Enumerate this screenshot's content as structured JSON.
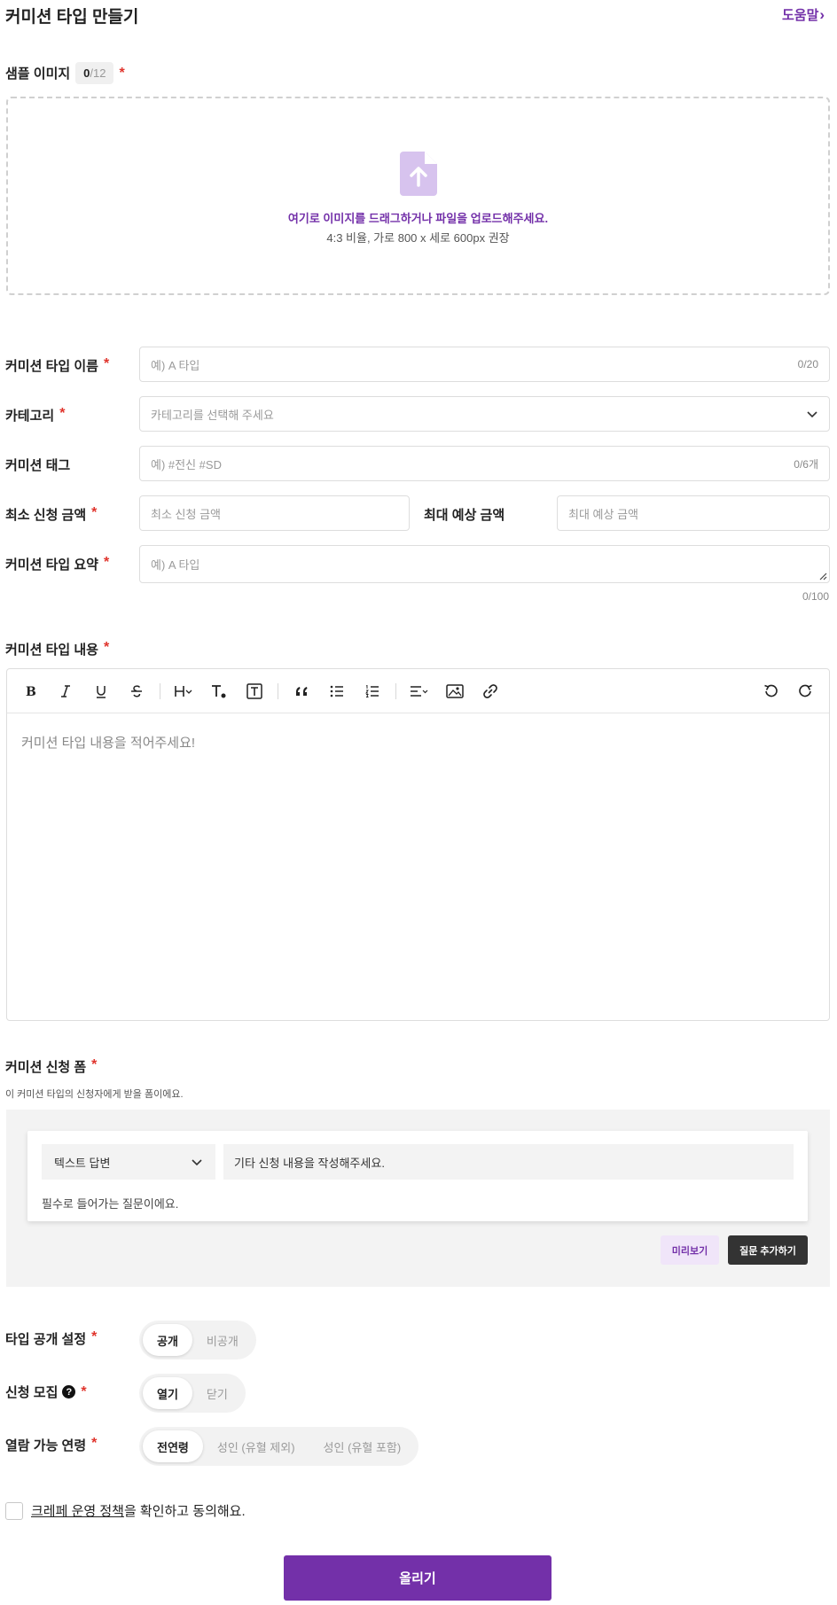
{
  "header": {
    "title": "커미션 타입 만들기",
    "help_label": "도움말",
    "help_chevron": "›"
  },
  "colors": {
    "accent": "#7330a9",
    "required": "#e0342c",
    "upload_icon": "#d7c3ee"
  },
  "sample": {
    "label": "샘플 이미지",
    "count_current": "0",
    "count_max": "/12",
    "required_mark": "*",
    "upload_text": "여기로 이미지를 드래그하거나 파일을 업로드해주세요.",
    "upload_hint": "4:3 비율, 가로 800 x 세로 600px 권장"
  },
  "fields": {
    "name": {
      "label": "커미션 타입 이름",
      "placeholder": "예) A 타입",
      "counter": "0/20"
    },
    "category": {
      "label": "카테고리",
      "placeholder": "카테고리를 선택해 주세요"
    },
    "tags": {
      "label": "커미션 태그",
      "placeholder": "예) #전신 #SD",
      "counter": "0/6개"
    },
    "min_price": {
      "label": "최소 신청 금액",
      "placeholder": "최소 신청 금액"
    },
    "max_price": {
      "label": "최대 예상 금액",
      "placeholder": "최대 예상 금액"
    },
    "summary": {
      "label": "커미션 타입 요약",
      "placeholder": "예) A 타입",
      "counter": "0/100"
    }
  },
  "content": {
    "label": "커미션 타입 내용",
    "placeholder": "커미션 타입 내용을 적어주세요!",
    "toolbar": [
      "bold-icon",
      "italic-icon",
      "underline-icon",
      "strikethrough-icon",
      "heading-icon",
      "text-color-icon",
      "text-box-icon",
      "quote-icon",
      "bullet-list-icon",
      "numbered-list-icon",
      "align-icon",
      "image-icon",
      "link-icon",
      "undo-icon",
      "redo-icon"
    ]
  },
  "form": {
    "label": "커미션 신청 폼",
    "description": "이 커미션 타입의 신청자에게 받을 폼이에요.",
    "question_type": "텍스트 답변",
    "question_text": "기타 신청 내용을 작성해주세요.",
    "required_note": "필수로 들어가는 질문이에요.",
    "preview_label": "미리보기",
    "add_question_label": "질문 추가하기"
  },
  "settings": {
    "visibility": {
      "label": "타입 공개 설정",
      "options": [
        "공개",
        "비공개"
      ],
      "selected": "공개"
    },
    "recruit": {
      "label": "신청 모집",
      "options": [
        "열기",
        "닫기"
      ],
      "selected": "열기"
    },
    "age": {
      "label": "열람 가능 연령",
      "options": [
        "전연령",
        "성인 (유혈 제외)",
        "성인 (유혈 포함)"
      ],
      "selected": "전연령"
    }
  },
  "agree": {
    "link_text": "크레페 운영 정책",
    "rest_text": "을 확인하고 동의해요."
  },
  "submit_label": "올리기"
}
